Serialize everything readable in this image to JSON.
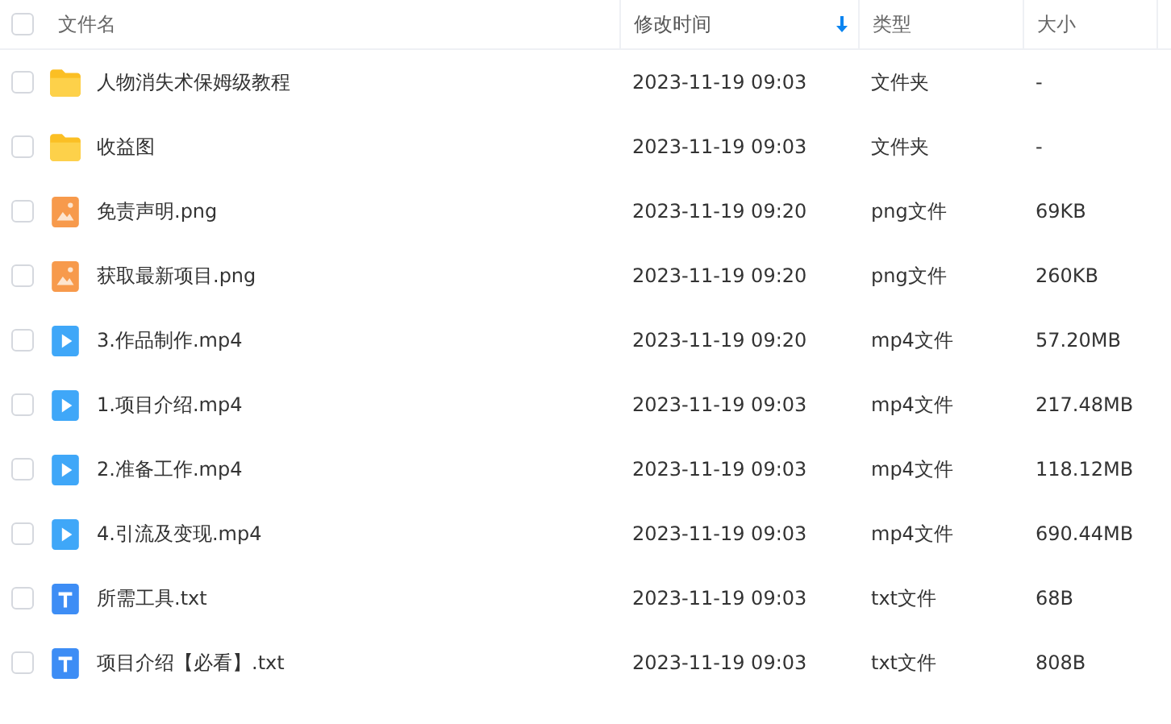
{
  "table": {
    "select_all": {
      "checked": false
    },
    "columns": [
      {
        "label": "文件名",
        "sorted": false
      },
      {
        "label": "修改时间",
        "sorted": true
      },
      {
        "label": "类型",
        "sorted": false
      },
      {
        "label": "大小",
        "sorted": false
      }
    ],
    "rows": [
      {
        "kind": "folder",
        "name": "人物消失术保姆级教程",
        "modified": "2023-11-19 09:03",
        "type": "文件夹",
        "size": "-",
        "checked": false
      },
      {
        "kind": "folder",
        "name": "收益图",
        "modified": "2023-11-19 09:03",
        "type": "文件夹",
        "size": "-",
        "checked": false
      },
      {
        "kind": "image",
        "name": "免责声明.png",
        "modified": "2023-11-19 09:20",
        "type": "png文件",
        "size": "69KB",
        "checked": false
      },
      {
        "kind": "image",
        "name": "获取最新项目.png",
        "modified": "2023-11-19 09:20",
        "type": "png文件",
        "size": "260KB",
        "checked": false
      },
      {
        "kind": "video",
        "name": "3.作品制作.mp4",
        "modified": "2023-11-19 09:20",
        "type": "mp4文件",
        "size": "57.20MB",
        "checked": false
      },
      {
        "kind": "video",
        "name": "1.项目介绍.mp4",
        "modified": "2023-11-19 09:03",
        "type": "mp4文件",
        "size": "217.48MB",
        "checked": false
      },
      {
        "kind": "video",
        "name": "2.准备工作.mp4",
        "modified": "2023-11-19 09:03",
        "type": "mp4文件",
        "size": "118.12MB",
        "checked": false
      },
      {
        "kind": "video",
        "name": "4.引流及变现.mp4",
        "modified": "2023-11-19 09:03",
        "type": "mp4文件",
        "size": "690.44MB",
        "checked": false
      },
      {
        "kind": "text",
        "name": "所需工具.txt",
        "modified": "2023-11-19 09:03",
        "type": "txt文件",
        "size": "68B",
        "checked": false
      },
      {
        "kind": "text",
        "name": "项目介绍【必看】.txt",
        "modified": "2023-11-19 09:03",
        "type": "txt文件",
        "size": "808B",
        "checked": false
      }
    ]
  }
}
